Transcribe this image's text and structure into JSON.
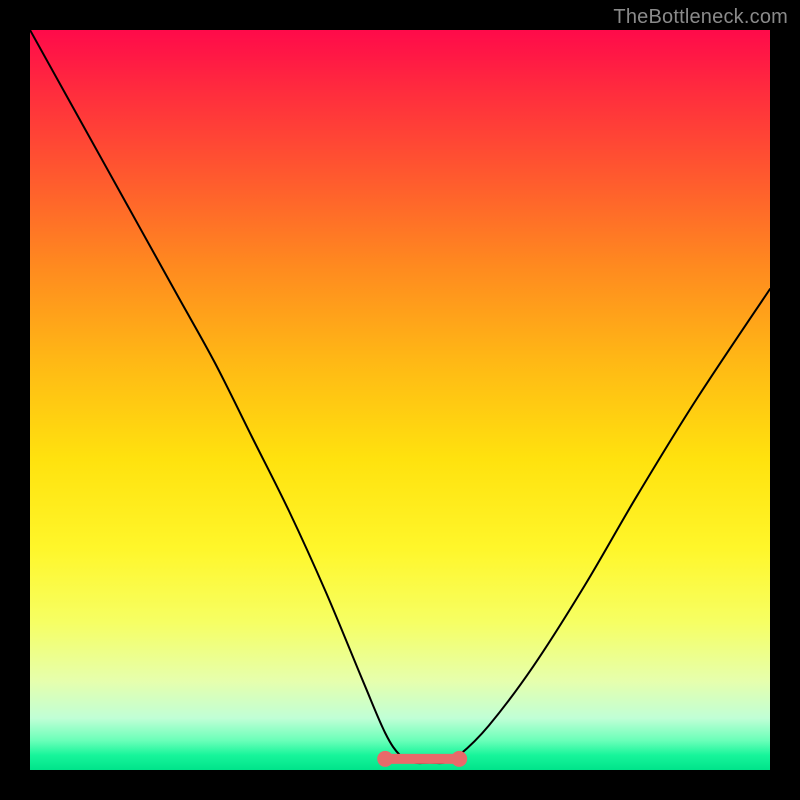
{
  "watermark": "TheBottleneck.com",
  "colors": {
    "frame": "#000000",
    "curve": "#000000",
    "marker_fill": "#e76a6a",
    "marker_stroke": "#c94f4f"
  },
  "chart_data": {
    "type": "line",
    "title": "",
    "xlabel": "",
    "ylabel": "",
    "xlim": [
      0,
      100
    ],
    "ylim": [
      0,
      100
    ],
    "grid": false,
    "legend": false,
    "series": [
      {
        "name": "bottleneck-curve",
        "x": [
          0,
          5,
          10,
          15,
          20,
          25,
          30,
          35,
          40,
          45,
          48,
          50,
          52,
          54,
          56,
          58,
          62,
          68,
          75,
          82,
          90,
          100
        ],
        "values": [
          100,
          91,
          82,
          73,
          64,
          55,
          45,
          35,
          24,
          12,
          5,
          2,
          1,
          1,
          1,
          2,
          6,
          14,
          25,
          37,
          50,
          65
        ]
      }
    ],
    "flat_region": {
      "x_start": 48,
      "x_end": 58,
      "y": 1.5,
      "endpoint_radius": 1.2
    }
  }
}
